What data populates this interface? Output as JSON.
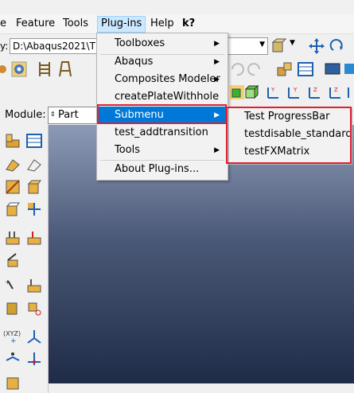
{
  "menubar": {
    "items": [
      "e",
      "Feature",
      "Tools",
      "Plug-ins",
      "Help",
      "k?"
    ]
  },
  "toolbar": {
    "path_prefix": "y:",
    "path_value": "D:\\Abaqus2021\\T"
  },
  "module": {
    "label": "Module:",
    "value": "Part"
  },
  "plugins_menu": {
    "items": [
      {
        "label": "Toolboxes",
        "submenu": true
      },
      {
        "label": "Abaqus",
        "submenu": true
      },
      {
        "label": "Composites Modeler",
        "submenu": true
      },
      {
        "label": "createPlateWithhole",
        "submenu": false
      },
      {
        "label": "Submenu",
        "submenu": true,
        "selected": true
      },
      {
        "label": "test_addtransition",
        "submenu": false
      },
      {
        "label": "Tools",
        "submenu": true
      },
      {
        "label": "About Plug-ins...",
        "submenu": false
      }
    ]
  },
  "submenu": {
    "items": [
      "Test ProgressBar",
      "testdisable_standard",
      "testFXMatrix"
    ]
  },
  "colors": {
    "highlight": "#e02030",
    "selection": "#0078d7",
    "viewport_top": "#8c9ab7",
    "viewport_bottom": "#1f2c48"
  }
}
